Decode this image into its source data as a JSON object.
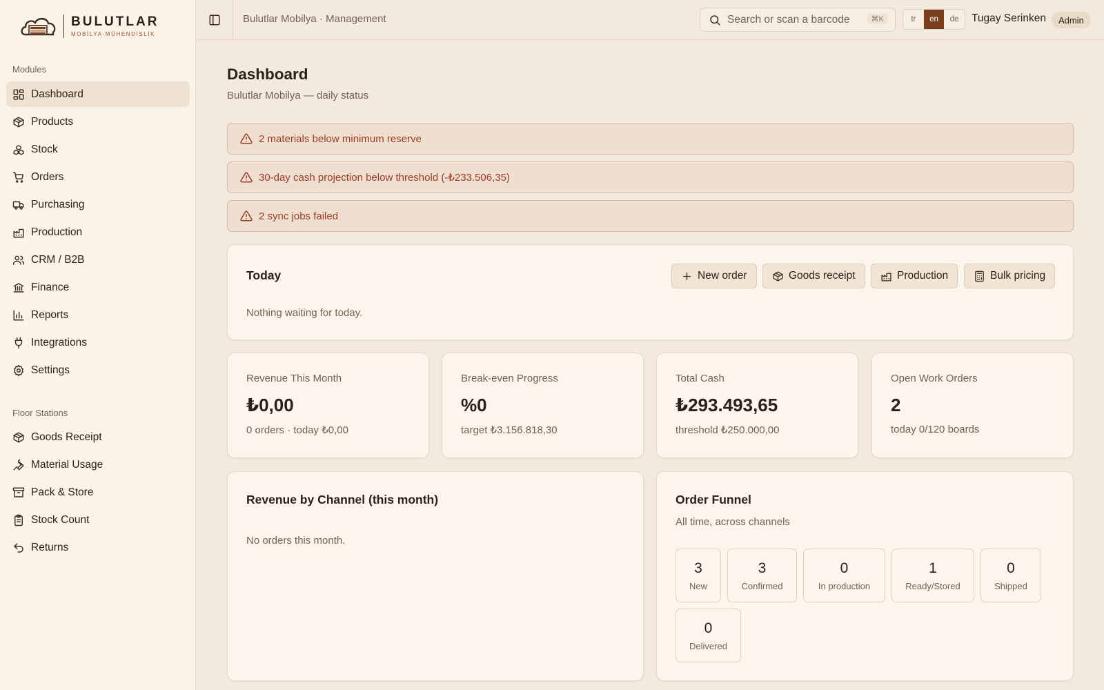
{
  "brand": {
    "name": "BULUTLAR",
    "tagline": "MOBİLYA-MÜHENDİSLİK"
  },
  "sidebar": {
    "modules_heading": "Modules",
    "modules": [
      {
        "label": "Dashboard",
        "icon": "dashboard-icon",
        "active": true
      },
      {
        "label": "Products",
        "icon": "package-icon"
      },
      {
        "label": "Stock",
        "icon": "boxes-icon"
      },
      {
        "label": "Orders",
        "icon": "cart-icon"
      },
      {
        "label": "Purchasing",
        "icon": "truck-icon"
      },
      {
        "label": "Production",
        "icon": "factory-icon"
      },
      {
        "label": "CRM / B2B",
        "icon": "users-icon"
      },
      {
        "label": "Finance",
        "icon": "bank-icon"
      },
      {
        "label": "Reports",
        "icon": "bar-chart-icon"
      },
      {
        "label": "Integrations",
        "icon": "plug-icon"
      },
      {
        "label": "Settings",
        "icon": "gear-icon"
      }
    ],
    "stations_heading": "Floor Stations",
    "stations": [
      {
        "label": "Goods Receipt",
        "icon": "package-icon"
      },
      {
        "label": "Material Usage",
        "icon": "wrench-icon"
      },
      {
        "label": "Pack & Store",
        "icon": "archive-icon"
      },
      {
        "label": "Stock Count",
        "icon": "clipboard-icon"
      },
      {
        "label": "Returns",
        "icon": "undo-icon"
      }
    ]
  },
  "topbar": {
    "breadcrumb": "Bulutlar Mobilya · Management",
    "search_placeholder": "Search or scan a barcode",
    "search_shortcut": "⌘K",
    "languages": [
      "tr",
      "en",
      "de"
    ],
    "active_language": "en",
    "user_name": "Tugay Serinken",
    "user_role": "Admin"
  },
  "page": {
    "title": "Dashboard",
    "subtitle": "Bulutlar Mobilya — daily status"
  },
  "alerts": [
    "2 materials below minimum reserve",
    "30-day cash projection below threshold (-₺233.506,35)",
    "2 sync jobs failed"
  ],
  "today": {
    "title": "Today",
    "empty_text": "Nothing waiting for today.",
    "actions": [
      {
        "label": "New order",
        "icon": "plus-icon"
      },
      {
        "label": "Goods receipt",
        "icon": "package-icon"
      },
      {
        "label": "Production",
        "icon": "factory-icon"
      },
      {
        "label": "Bulk pricing",
        "icon": "calculator-icon"
      }
    ]
  },
  "stats": [
    {
      "label": "Revenue This Month",
      "value": "₺0,00",
      "sub": "0 orders · today ₺0,00"
    },
    {
      "label": "Break-even Progress",
      "value": "%0",
      "sub": "target ₺3.156.818,30"
    },
    {
      "label": "Total Cash",
      "value": "₺293.493,65",
      "sub": "threshold ₺250.000,00"
    },
    {
      "label": "Open Work Orders",
      "value": "2",
      "sub": "today 0/120 boards"
    }
  ],
  "channel_revenue": {
    "title": "Revenue by Channel (this month)",
    "empty_text": "No orders this month."
  },
  "funnel": {
    "title": "Order Funnel",
    "subtitle": "All time, across channels",
    "stages": [
      {
        "count": "3",
        "label": "New"
      },
      {
        "count": "3",
        "label": "Confirmed"
      },
      {
        "count": "0",
        "label": "In production"
      },
      {
        "count": "1",
        "label": "Ready/Stored"
      },
      {
        "count": "0",
        "label": "Shipped"
      },
      {
        "count": "0",
        "label": "Delivered"
      }
    ]
  },
  "colors": {
    "background": "#f3e9dc",
    "sidebar": "#faf3e8",
    "accent": "#7a3e1d",
    "alert_text": "#9a3a26",
    "alert_bg": "#efdfd0"
  }
}
